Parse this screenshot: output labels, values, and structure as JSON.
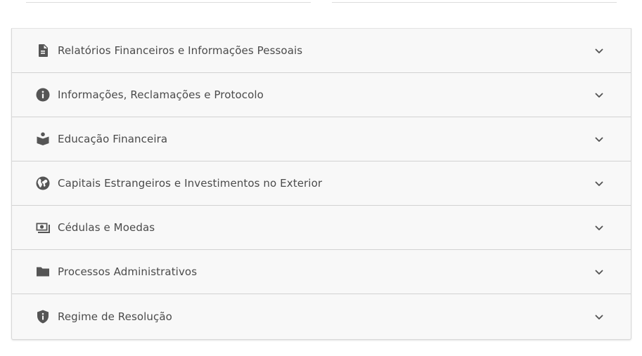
{
  "accordion": {
    "items": [
      {
        "label": "Relatórios Financeiros e Informações Pessoais",
        "icon": "document-icon"
      },
      {
        "label": "Informações, Reclamações e Protocolo",
        "icon": "info-icon"
      },
      {
        "label": "Educação Financeira",
        "icon": "reader-icon"
      },
      {
        "label": "Capitais Estrangeiros e Investimentos no Exterior",
        "icon": "globe-icon"
      },
      {
        "label": "Cédulas e Moedas",
        "icon": "money-icon"
      },
      {
        "label": "Processos Administrativos",
        "icon": "folder-icon"
      },
      {
        "label": "Regime de Resolução",
        "icon": "shield-icon"
      }
    ]
  }
}
